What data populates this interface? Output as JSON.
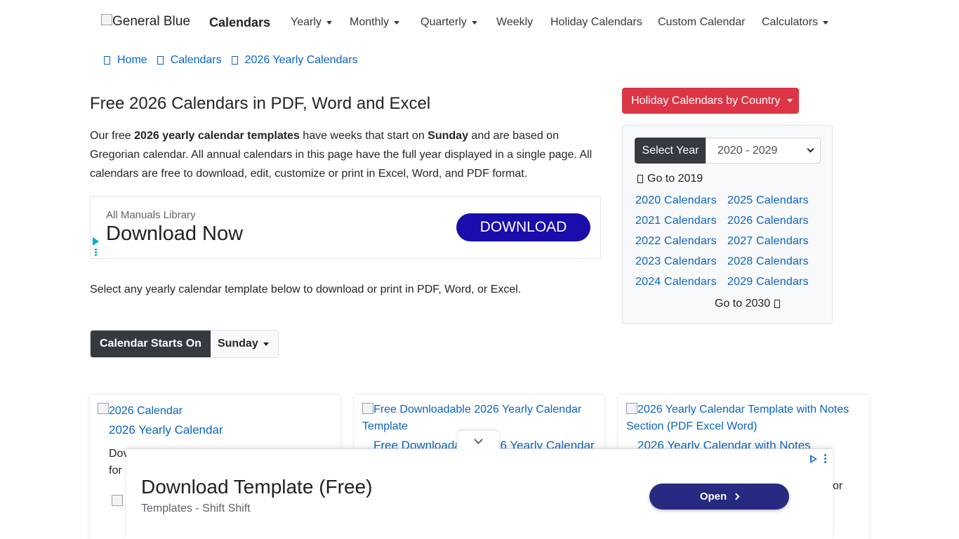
{
  "navbar": {
    "brand_alt": "General Blue",
    "brand_text": "Calendars",
    "items": [
      {
        "label": "Yearly",
        "dropdown": true
      },
      {
        "label": "Monthly",
        "dropdown": true
      },
      {
        "label": "Quarterly",
        "dropdown": true
      },
      {
        "label": "Weekly",
        "dropdown": false
      },
      {
        "label": "Holiday Calendars",
        "dropdown": false
      },
      {
        "label": "Custom Calendar",
        "dropdown": false
      },
      {
        "label": "Calculators",
        "dropdown": true
      }
    ]
  },
  "breadcrumb": [
    "Home",
    "Calendars",
    "2026 Yearly Calendars"
  ],
  "main": {
    "title": "Free 2026 Calendars in PDF, Word and Excel",
    "intro_1": "Our free ",
    "intro_b1": "2026 yearly calendar templates",
    "intro_2": " have weeks that start on ",
    "intro_b2": "Sunday",
    "intro_3": " and are based on Gregorian calendar. All annual calendars in this page have the full year displayed in a single page. All calendars are free to download, edit, customize or print in Excel, Word, and PDF format.",
    "select_text": "Select any yearly calendar template below to download or print in PDF, Word, or Excel.",
    "starts_on_label": "Calendar Starts On",
    "starts_on_value": "Sunday"
  },
  "top_ad": {
    "source": "All Manuals Library",
    "headline": "Download Now",
    "button": "DOWNLOAD"
  },
  "sidebar": {
    "holiday_button": "Holiday Calendars by Country",
    "select_year_label": "Select Year",
    "select_year_value": "2020 - 2029",
    "go_prev": "Go to 2019",
    "go_next": "Go to 2030",
    "years_left": [
      "2020 Calendars",
      "2021 Calendars",
      "2022 Calendars",
      "2023 Calendars",
      "2024 Calendars"
    ],
    "years_right": [
      "2025 Calendars",
      "2026 Calendars",
      "2027 Calendars",
      "2028 Calendars",
      "2029 Calendars"
    ]
  },
  "cards": [
    {
      "img_alt": "2026 Calendar",
      "title": "2026 Yearly Calendar",
      "desc_1": "Dov",
      "desc_2": "for"
    },
    {
      "img_alt": "Free Downloadable 2026 Yearly Calendar Template",
      "title": "Free Downloadable 2026 Yearly Calendar"
    },
    {
      "img_alt": "2026 Yearly Calendar Template with Notes Section (PDF Excel Word)",
      "title": "2026 Yearly Calendar with Notes",
      "desc_tail": "or"
    }
  ],
  "bottom_ad": {
    "headline": "Download Template (Free)",
    "advertiser": "Templates - Shift Shift",
    "button": "Open"
  },
  "colors": {
    "link": "#0b64c0",
    "dark": "#343a40",
    "danger": "#dc3545",
    "ad_button": "#1a0dab",
    "bottom_ad_button": "#262a80"
  }
}
